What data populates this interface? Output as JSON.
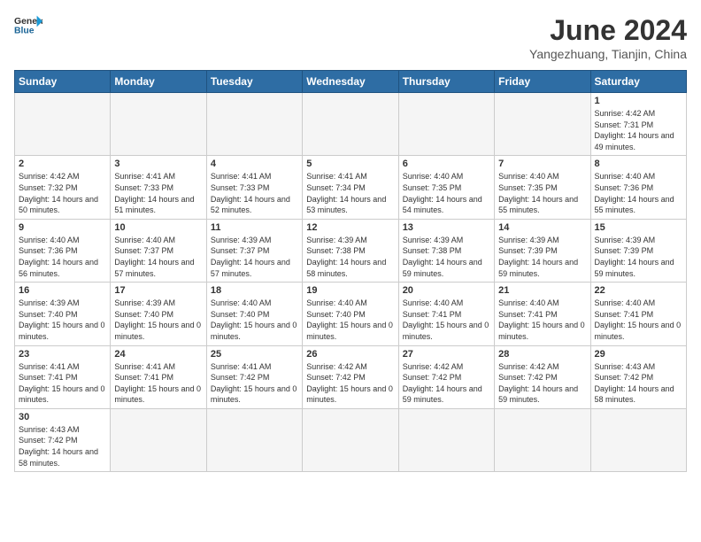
{
  "header": {
    "logo_general": "General",
    "logo_blue": "Blue",
    "title": "June 2024",
    "subtitle": "Yangezhuang, Tianjin, China"
  },
  "weekdays": [
    "Sunday",
    "Monday",
    "Tuesday",
    "Wednesday",
    "Thursday",
    "Friday",
    "Saturday"
  ],
  "weeks": [
    [
      {
        "day": "",
        "info": "",
        "empty": true
      },
      {
        "day": "",
        "info": "",
        "empty": true
      },
      {
        "day": "",
        "info": "",
        "empty": true
      },
      {
        "day": "",
        "info": "",
        "empty": true
      },
      {
        "day": "",
        "info": "",
        "empty": true
      },
      {
        "day": "",
        "info": "",
        "empty": true
      },
      {
        "day": "1",
        "info": "Sunrise: 4:42 AM\nSunset: 7:31 PM\nDaylight: 14 hours and 49 minutes."
      }
    ],
    [
      {
        "day": "2",
        "info": "Sunrise: 4:42 AM\nSunset: 7:32 PM\nDaylight: 14 hours and 50 minutes."
      },
      {
        "day": "3",
        "info": "Sunrise: 4:41 AM\nSunset: 7:33 PM\nDaylight: 14 hours and 51 minutes."
      },
      {
        "day": "4",
        "info": "Sunrise: 4:41 AM\nSunset: 7:33 PM\nDaylight: 14 hours and 52 minutes."
      },
      {
        "day": "5",
        "info": "Sunrise: 4:41 AM\nSunset: 7:34 PM\nDaylight: 14 hours and 53 minutes."
      },
      {
        "day": "6",
        "info": "Sunrise: 4:40 AM\nSunset: 7:35 PM\nDaylight: 14 hours and 54 minutes."
      },
      {
        "day": "7",
        "info": "Sunrise: 4:40 AM\nSunset: 7:35 PM\nDaylight: 14 hours and 55 minutes."
      },
      {
        "day": "8",
        "info": "Sunrise: 4:40 AM\nSunset: 7:36 PM\nDaylight: 14 hours and 55 minutes."
      }
    ],
    [
      {
        "day": "9",
        "info": "Sunrise: 4:40 AM\nSunset: 7:36 PM\nDaylight: 14 hours and 56 minutes."
      },
      {
        "day": "10",
        "info": "Sunrise: 4:40 AM\nSunset: 7:37 PM\nDaylight: 14 hours and 57 minutes."
      },
      {
        "day": "11",
        "info": "Sunrise: 4:39 AM\nSunset: 7:37 PM\nDaylight: 14 hours and 57 minutes."
      },
      {
        "day": "12",
        "info": "Sunrise: 4:39 AM\nSunset: 7:38 PM\nDaylight: 14 hours and 58 minutes."
      },
      {
        "day": "13",
        "info": "Sunrise: 4:39 AM\nSunset: 7:38 PM\nDaylight: 14 hours and 59 minutes."
      },
      {
        "day": "14",
        "info": "Sunrise: 4:39 AM\nSunset: 7:39 PM\nDaylight: 14 hours and 59 minutes."
      },
      {
        "day": "15",
        "info": "Sunrise: 4:39 AM\nSunset: 7:39 PM\nDaylight: 14 hours and 59 minutes."
      }
    ],
    [
      {
        "day": "16",
        "info": "Sunrise: 4:39 AM\nSunset: 7:40 PM\nDaylight: 15 hours and 0 minutes."
      },
      {
        "day": "17",
        "info": "Sunrise: 4:39 AM\nSunset: 7:40 PM\nDaylight: 15 hours and 0 minutes."
      },
      {
        "day": "18",
        "info": "Sunrise: 4:40 AM\nSunset: 7:40 PM\nDaylight: 15 hours and 0 minutes."
      },
      {
        "day": "19",
        "info": "Sunrise: 4:40 AM\nSunset: 7:40 PM\nDaylight: 15 hours and 0 minutes."
      },
      {
        "day": "20",
        "info": "Sunrise: 4:40 AM\nSunset: 7:41 PM\nDaylight: 15 hours and 0 minutes."
      },
      {
        "day": "21",
        "info": "Sunrise: 4:40 AM\nSunset: 7:41 PM\nDaylight: 15 hours and 0 minutes."
      },
      {
        "day": "22",
        "info": "Sunrise: 4:40 AM\nSunset: 7:41 PM\nDaylight: 15 hours and 0 minutes."
      }
    ],
    [
      {
        "day": "23",
        "info": "Sunrise: 4:41 AM\nSunset: 7:41 PM\nDaylight: 15 hours and 0 minutes."
      },
      {
        "day": "24",
        "info": "Sunrise: 4:41 AM\nSunset: 7:41 PM\nDaylight: 15 hours and 0 minutes."
      },
      {
        "day": "25",
        "info": "Sunrise: 4:41 AM\nSunset: 7:42 PM\nDaylight: 15 hours and 0 minutes."
      },
      {
        "day": "26",
        "info": "Sunrise: 4:42 AM\nSunset: 7:42 PM\nDaylight: 15 hours and 0 minutes."
      },
      {
        "day": "27",
        "info": "Sunrise: 4:42 AM\nSunset: 7:42 PM\nDaylight: 14 hours and 59 minutes."
      },
      {
        "day": "28",
        "info": "Sunrise: 4:42 AM\nSunset: 7:42 PM\nDaylight: 14 hours and 59 minutes."
      },
      {
        "day": "29",
        "info": "Sunrise: 4:43 AM\nSunset: 7:42 PM\nDaylight: 14 hours and 58 minutes."
      }
    ],
    [
      {
        "day": "30",
        "info": "Sunrise: 4:43 AM\nSunset: 7:42 PM\nDaylight: 14 hours and 58 minutes."
      },
      {
        "day": "",
        "info": "",
        "empty": true
      },
      {
        "day": "",
        "info": "",
        "empty": true
      },
      {
        "day": "",
        "info": "",
        "empty": true
      },
      {
        "day": "",
        "info": "",
        "empty": true
      },
      {
        "day": "",
        "info": "",
        "empty": true
      },
      {
        "day": "",
        "info": "",
        "empty": true
      }
    ]
  ]
}
